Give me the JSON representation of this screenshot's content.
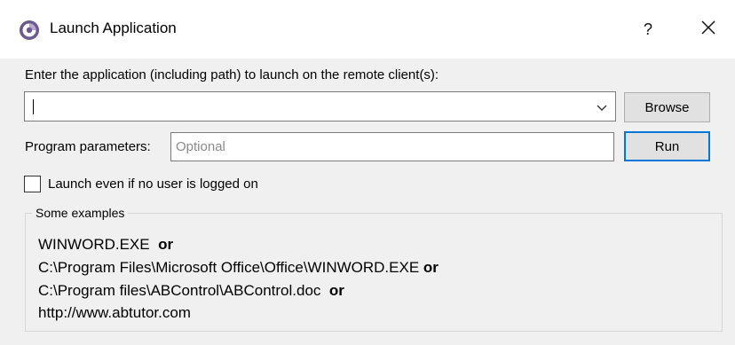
{
  "window": {
    "title": "Launch Application",
    "help_label": "?",
    "icons": {
      "app": "app-logo-icon",
      "close": "close-icon",
      "dropdown": "chevron-down-icon"
    }
  },
  "form": {
    "prompt_label": "Enter the application (including path) to launch on the remote client(s):",
    "app_path_value": "",
    "browse_label": "Browse",
    "params_label": "Program parameters:",
    "params_value": "",
    "params_placeholder": "Optional",
    "run_label": "Run",
    "checkbox_label": "Launch even if no user is logged on",
    "checkbox_checked": false
  },
  "examples": {
    "group_title": "Some examples",
    "lines": [
      {
        "path": "WINWORD.EXE",
        "suffix": "or"
      },
      {
        "path": "C:\\Program Files\\Microsoft Office\\Office\\WINWORD.EXE",
        "suffix": "or"
      },
      {
        "path": "C:\\Program files\\ABControl\\ABControl.doc",
        "suffix": "or"
      },
      {
        "path": "http://www.abtutor.com",
        "suffix": ""
      }
    ]
  },
  "colors": {
    "client_bg": "#f0f0f0",
    "default_button_border": "#0078d7",
    "placeholder_text": "#8a8a8a"
  }
}
